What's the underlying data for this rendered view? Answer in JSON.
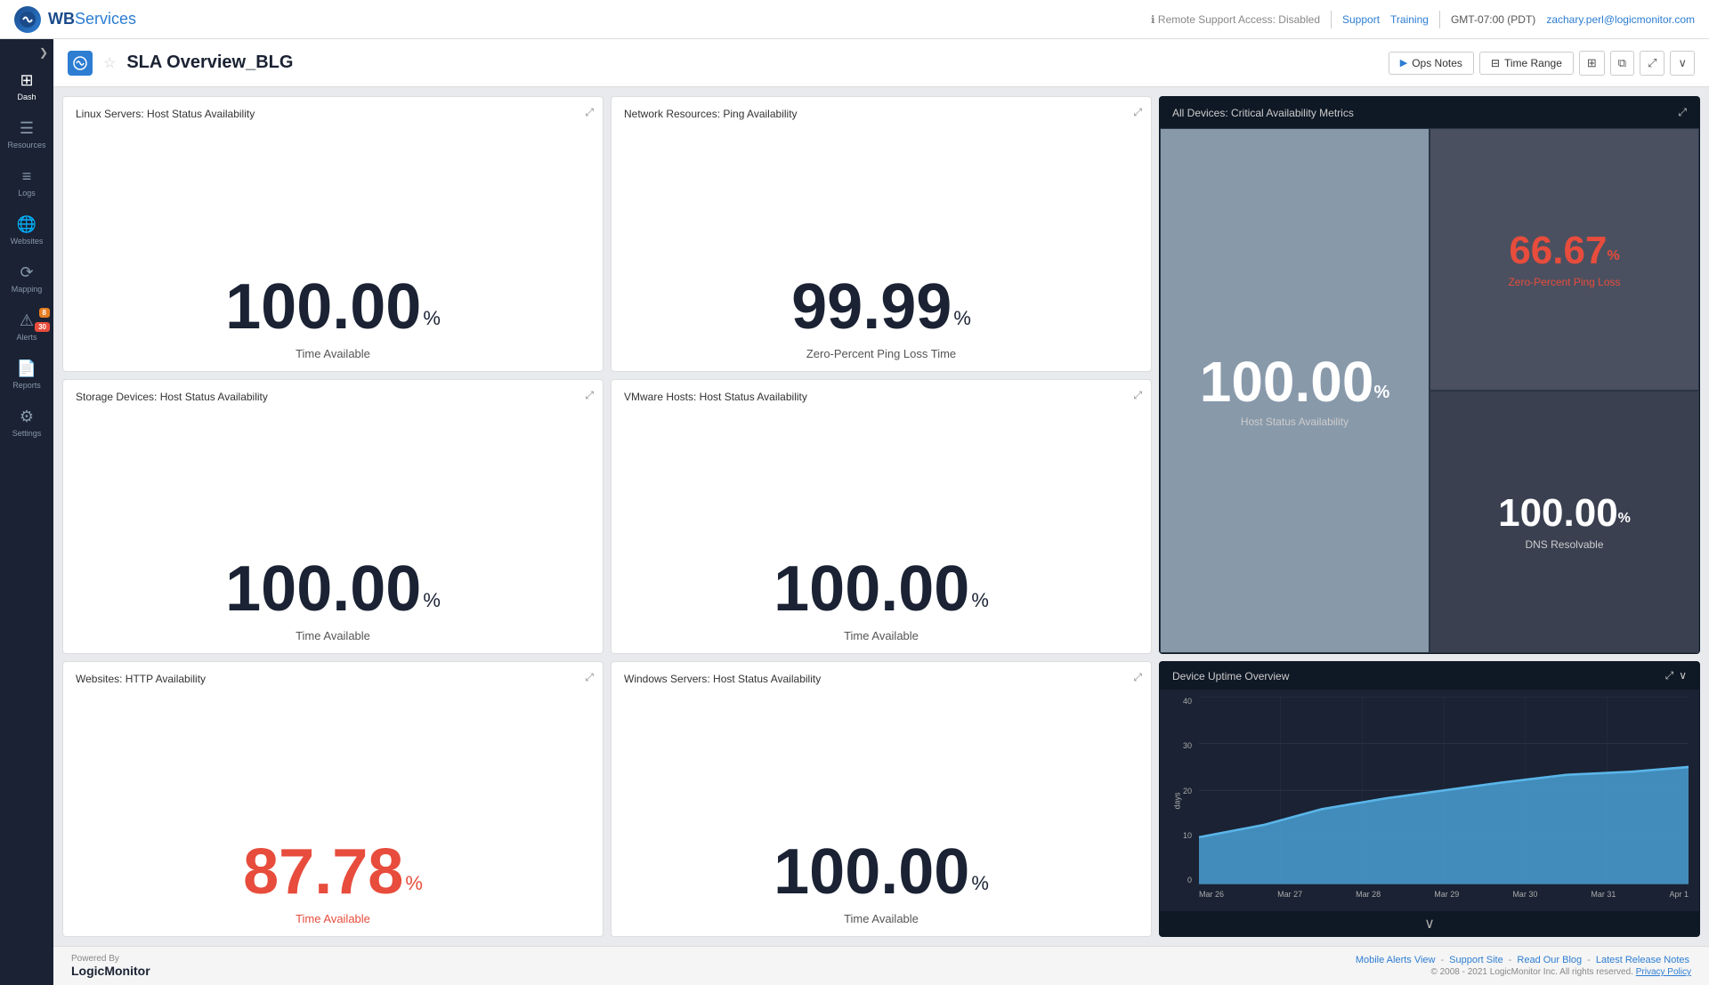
{
  "topbar": {
    "logo_wb": "WB",
    "logo_services": "Services",
    "remote_support": "Remote Support Access: Disabled",
    "support": "Support",
    "training": "Training",
    "timezone": "GMT-07:00 (PDT)",
    "user": "zachary.perl@logicmonitor.com"
  },
  "sidebar": {
    "nav_arrow": "❯",
    "items": [
      {
        "id": "dash",
        "icon": "⊞",
        "label": "Dash"
      },
      {
        "id": "resources",
        "icon": "☰",
        "label": "Resources"
      },
      {
        "id": "logs",
        "icon": "≡",
        "label": "Logs"
      },
      {
        "id": "websites",
        "icon": "🌐",
        "label": "Websites"
      },
      {
        "id": "mapping",
        "icon": "⟳",
        "label": "Mapping"
      },
      {
        "id": "alerts",
        "icon": "⚠",
        "label": "Alerts",
        "badge1": "8",
        "badge2": "30"
      },
      {
        "id": "reports",
        "icon": "📄",
        "label": "Reports"
      },
      {
        "id": "settings",
        "icon": "⚙",
        "label": "Settings"
      }
    ]
  },
  "header": {
    "icon": "≡",
    "star": "☆",
    "title": "SLA Overview_BLG",
    "ops_notes": "Ops Notes",
    "time_range": "Time Range",
    "btn_grid": "⊞",
    "btn_copy": "⧉",
    "btn_expand": "⤢",
    "btn_chevron": "∨"
  },
  "widgets": {
    "linux": {
      "title": "Linux Servers: Host Status Availability",
      "value": "100.00",
      "percent": "%",
      "label": "Time Available"
    },
    "network": {
      "title": "Network Resources: Ping Availability",
      "value": "99.99",
      "percent": "%",
      "label": "Zero-Percent Ping Loss Time"
    },
    "storage": {
      "title": "Storage Devices: Host Status Availability",
      "value": "100.00",
      "percent": "%",
      "label": "Time Available"
    },
    "vmware": {
      "title": "VMware Hosts: Host Status Availability",
      "value": "100.00",
      "percent": "%",
      "label": "Time Available"
    },
    "websites": {
      "title": "Websites: HTTP Availability",
      "value": "87.78",
      "percent": "%",
      "label": "Time Available",
      "color": "red"
    },
    "windows": {
      "title": "Windows Servers: Host Status Availability",
      "value": "100.00",
      "percent": "%",
      "label": "Time Available"
    },
    "critical_metrics": {
      "title": "All Devices: Critical Availability Metrics",
      "host_value": "100.00",
      "host_percent": "%",
      "host_label": "Host Status Availability",
      "ping_value": "66.67",
      "ping_percent": "%",
      "ping_label": "Zero-Percent Ping Loss",
      "dns_value": "100.00",
      "dns_percent": "%",
      "dns_label": "DNS Resolvable"
    },
    "uptime": {
      "title": "Device Uptime Overview",
      "y_labels": [
        "40",
        "30",
        "20",
        "10",
        "0"
      ],
      "x_labels": [
        "Mar 26",
        "Mar 27",
        "Mar 28",
        "Mar 29",
        "Mar 30",
        "Mar 31",
        "Apr 1"
      ],
      "days_label": "days"
    }
  },
  "footer": {
    "powered_by": "Powered By",
    "company": "LogicMonitor",
    "links": [
      "Mobile Alerts View",
      "Support Site",
      "Read Our Blog",
      "Latest Release Notes"
    ],
    "copyright": "© 2008 - 2021 LogicMonitor Inc. All rights reserved.",
    "privacy": "Privacy Policy"
  }
}
